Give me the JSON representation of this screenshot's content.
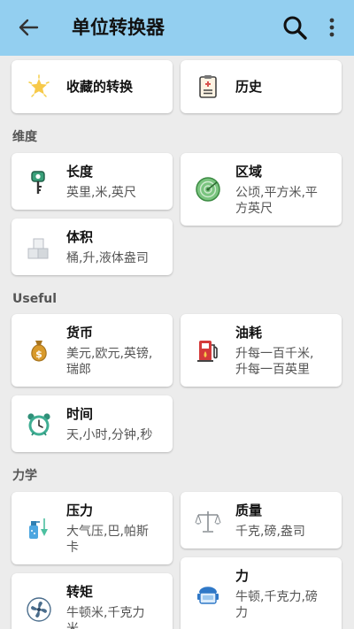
{
  "app_bar": {
    "title": "单位转换器",
    "back_icon": "arrow-back-icon",
    "search_icon": "search-icon",
    "more_icon": "more-vertical-icon",
    "background": "#93cff0"
  },
  "top_cards": [
    {
      "name": "收藏的转换",
      "icon": "star-icon"
    },
    {
      "name": "历史",
      "icon": "clipboard-icon"
    }
  ],
  "sections": [
    {
      "title": "维度",
      "items": [
        {
          "name": "长度",
          "units": "英里,米,英尺",
          "icon": "key-icon"
        },
        {
          "name": "区域",
          "units": "公顷,平方米,平\n方英尺",
          "icon": "radar-icon"
        },
        {
          "name": "体积",
          "units": "桶,升,液体盎司",
          "icon": "cubes-icon"
        }
      ]
    },
    {
      "title": "Useful",
      "items": [
        {
          "name": "货币",
          "units": "美元,欧元,英镑,\n瑞郎",
          "icon": "money-bag-icon"
        },
        {
          "name": "油耗",
          "units": "升每一百千米,\n升每一百英里",
          "icon": "fuel-pump-icon"
        },
        {
          "name": "时间",
          "units": "天,小时,分钟,秒",
          "icon": "alarm-clock-icon"
        }
      ]
    },
    {
      "title": "力学",
      "items": [
        {
          "name": "压力",
          "units": "大气压,巴,帕斯\n卡",
          "icon": "spray-bottle-icon"
        },
        {
          "name": "质量",
          "units": "千克,磅,盎司",
          "icon": "balance-scale-icon"
        },
        {
          "name": "转矩",
          "units": "牛顿米,千克力\n米",
          "icon": "fan-icon"
        },
        {
          "name": "力",
          "units": "牛顿,千克力,磅\n力",
          "icon": "robot-icon"
        }
      ]
    }
  ]
}
